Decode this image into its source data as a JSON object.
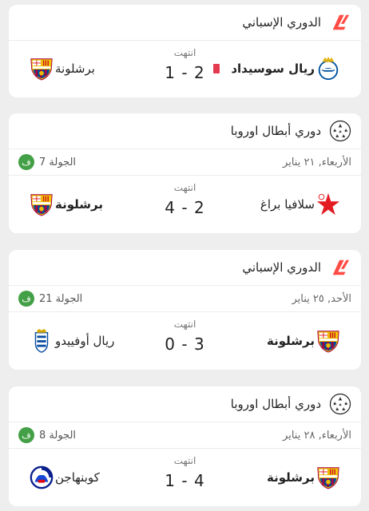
{
  "cards": [
    {
      "competition": "الدوري الإسباني",
      "competition_icon": "laliga-logo",
      "status": "انتهت",
      "home": {
        "name": "ريال سوسيداد",
        "crest": "real-sociedad-crest",
        "red_card": true
      },
      "away": {
        "name": "برشلونة",
        "crest": "barcelona-crest"
      },
      "score": "1 - 2"
    },
    {
      "competition": "دوري أبطال اوروبا",
      "competition_icon": "champions-league-logo",
      "date": "الأربعاء, ٢١ يناير",
      "round": "الجولة 7",
      "badge": "ف",
      "status": "انتهت",
      "home": {
        "name": "سلافيا براغ",
        "crest": "slavia-prague-crest"
      },
      "away": {
        "name": "برشلونة",
        "crest": "barcelona-crest"
      },
      "score": "4 - 2"
    },
    {
      "competition": "الدوري الإسباني",
      "competition_icon": "laliga-logo",
      "date": "الأحد, ٢٥ يناير",
      "round": "الجولة 21",
      "badge": "ف",
      "status": "انتهت",
      "home": {
        "name": "برشلونة",
        "crest": "barcelona-crest"
      },
      "away": {
        "name": "ريال أوفييدو",
        "crest": "real-oviedo-crest"
      },
      "score": "0 - 3"
    },
    {
      "competition": "دوري أبطال اوروبا",
      "competition_icon": "champions-league-logo",
      "date": "الأربعاء, ٢٨ يناير",
      "round": "الجولة 8",
      "badge": "ف",
      "status": "انتهت",
      "home": {
        "name": "برشلونة",
        "crest": "barcelona-crest"
      },
      "away": {
        "name": "كوبنهاجن",
        "crest": "copenhagen-crest"
      },
      "score": "1 - 4"
    }
  ],
  "colors": {
    "accent_green": "#43a047",
    "red_card": "#e53950",
    "laliga_red": "#ff4b44",
    "barca_blue": "#004d98",
    "barca_garnet": "#a50044"
  }
}
